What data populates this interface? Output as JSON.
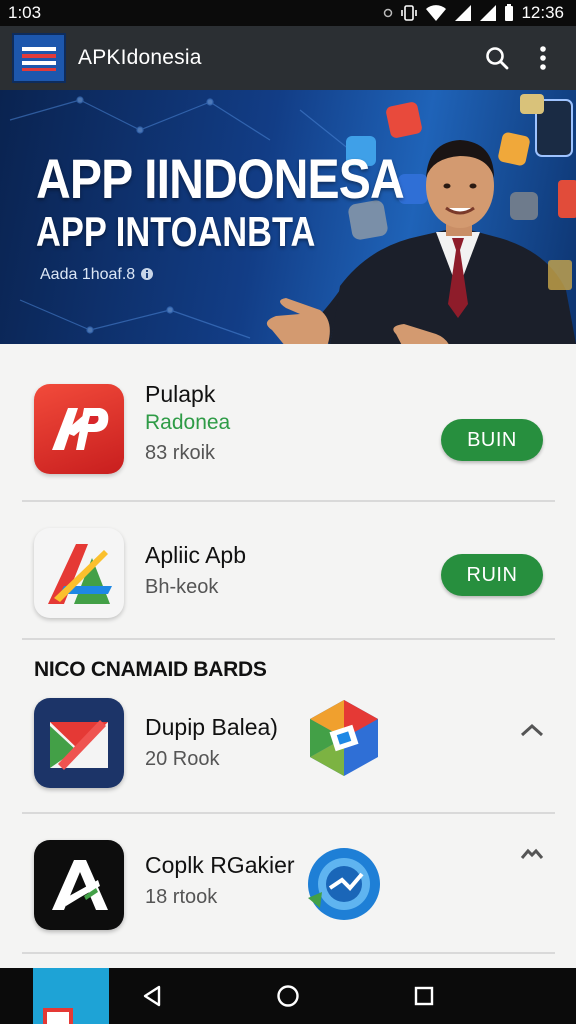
{
  "status_bar": {
    "time_left": "1:03",
    "time_right": "12:36"
  },
  "app_bar": {
    "title": "APKIdonesia"
  },
  "banner": {
    "title_line1": "APP IINDONESA",
    "title_line2": "APP INTOANBTA",
    "caption": "Aada 1hoaf.8"
  },
  "apps": [
    {
      "name": "Pulapk",
      "subtitle": "Radonea",
      "meta": "83 rkoik",
      "button": "BUIN"
    },
    {
      "name": "Apliic Apb",
      "meta": "Bh-keok",
      "button": "RUIN"
    }
  ],
  "section": {
    "title": "NICO CNAMAID BARDS",
    "items": [
      {
        "name": "Dupip Balea)",
        "meta": "20 Rook"
      },
      {
        "name": "Coplk RGakier",
        "meta": "18 rtook"
      }
    ]
  },
  "colors": {
    "accent_green": "#278f3e",
    "subtitle_green": "#2e9b46",
    "app_bar": "#2b2f33"
  }
}
